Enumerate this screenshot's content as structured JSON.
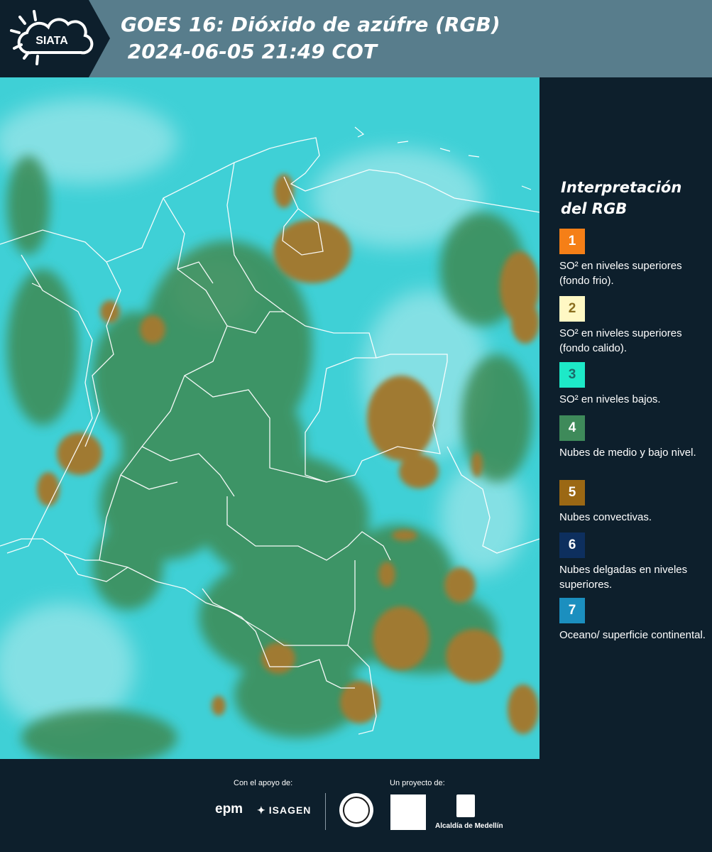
{
  "header": {
    "logo_text": "SIATA",
    "title": "GOES 16: Dióxido de azúfre (RGB)\n 2024-06-05 21:49 COT"
  },
  "map": {
    "base_color": "#3fd0d6",
    "convective_color": "#a07a30",
    "low_cloud_color": "#3e8a52",
    "border_color": "#ffffff"
  },
  "legend": {
    "title": "Interpretación del RGB",
    "items": [
      {
        "num": "1",
        "text": "SO² en niveles superiores (fondo frio).",
        "color": "#f57f17",
        "numcolor": "#ffffff"
      },
      {
        "num": "2",
        "text": "SO² en niveles superiores (fondo calido).",
        "color": "#fff8c4",
        "numcolor": "#8a6d1e"
      },
      {
        "num": "3",
        "text": "SO² en niveles bajos.",
        "color": "#1de9c8",
        "numcolor": "#1c6a6a"
      },
      {
        "num": "4",
        "text": "Nubes de medio y bajo nivel.",
        "color": "#3e8a5a",
        "numcolor": "#ffffff"
      },
      {
        "num": "5",
        "text": "Nubes convectivas.",
        "color": "#9b6814",
        "numcolor": "#ffffff"
      },
      {
        "num": "6",
        "text": "Nubes delgadas en niveles superiores.",
        "color": "#0d2f5e",
        "numcolor": "#ffffff"
      },
      {
        "num": "7",
        "text": "Oceano/ superficie continental.",
        "color": "#1b8fbf",
        "numcolor": "#ffffff"
      }
    ]
  },
  "footer": {
    "support_label": "Con el apoyo de:",
    "project_label": "Un proyecto de:",
    "epm": "epm",
    "isagen": "ISAGEN",
    "alcaldia": "Alcaldía de Medellín"
  }
}
